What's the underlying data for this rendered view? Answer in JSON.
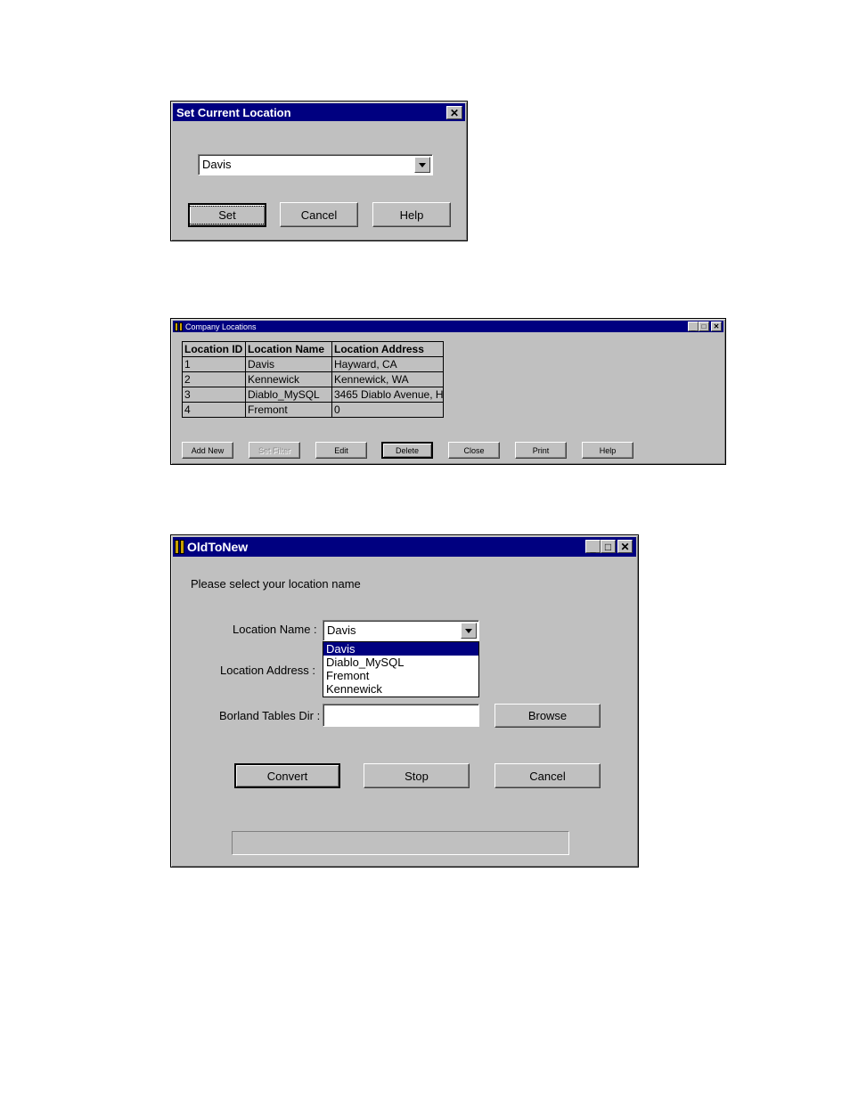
{
  "dialog1": {
    "title": "Set Current Location",
    "location_value": "Davis",
    "set_label": "Set",
    "cancel_label": "Cancel",
    "help_label": "Help"
  },
  "dialog2": {
    "title": "Company Locations",
    "columns": [
      "Location ID",
      "Location Name",
      "Location Address"
    ],
    "rows": [
      [
        "1",
        "Davis",
        "Hayward, CA"
      ],
      [
        "2",
        "Kennewick",
        "Kennewick, WA"
      ],
      [
        "3",
        "Diablo_MySQL",
        "3465 Diablo Avenue, H"
      ],
      [
        "4",
        "Fremont",
        "0"
      ]
    ],
    "buttons": [
      "Add New",
      "Set Filter",
      "Edit",
      "Delete",
      "Close",
      "Print",
      "Help"
    ]
  },
  "dialog3": {
    "title": "OldToNew",
    "prompt": "Please select your location name",
    "location_name_label": "Location  Name :",
    "location_name_value": "Davis",
    "location_address_label": "Location  Address :",
    "borland_label": "Borland Tables Dir :",
    "borland_value": "",
    "dropdown_options": [
      "Davis",
      "Diablo_MySQL",
      "Fremont",
      "Kennewick"
    ],
    "browse_label": "Browse",
    "convert_label": "Convert",
    "stop_label": "Stop",
    "cancel_label": "Cancel"
  },
  "icons": {
    "close": "close-icon",
    "minimize": "minimize-icon",
    "maximize": "maximize-icon",
    "dropdown": "chevron-down-icon"
  },
  "colors": {
    "titlebar": "#000080",
    "face": "#c0c0c0",
    "selection": "#000080"
  }
}
